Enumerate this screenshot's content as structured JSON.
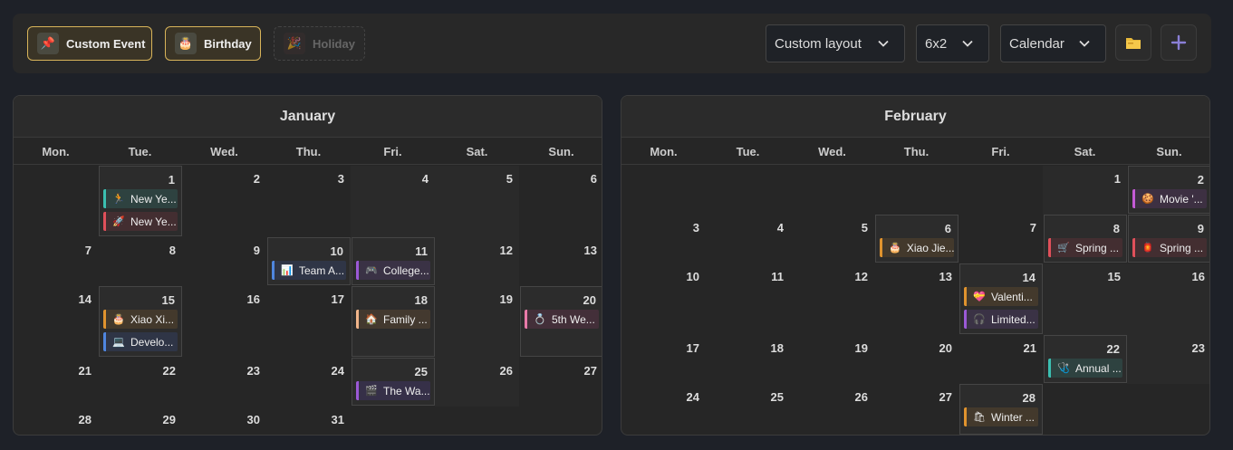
{
  "filters": [
    {
      "label": "Custom Event",
      "icon": "📌",
      "icon_name": "pushpin-icon",
      "active": true
    },
    {
      "label": "Birthday",
      "icon": "🎂",
      "icon_name": "cake-icon",
      "active": true
    },
    {
      "label": "Holiday",
      "icon": "🎉",
      "icon_name": "party-popper-icon",
      "active": false
    }
  ],
  "controls": {
    "layout": "Custom layout",
    "grid": "6x2",
    "view": "Calendar"
  },
  "weekdays": [
    "Mon.",
    "Tue.",
    "Wed.",
    "Thu.",
    "Fri.",
    "Sat.",
    "Sun."
  ],
  "colors": {
    "teal": "#3bbfb1",
    "red": "#e0505a",
    "orange": "#e0932e",
    "blue": "#4f86e0",
    "purple": "#9b59d6",
    "peach": "#f0b48a",
    "pink": "#e87aa8",
    "magenta": "#c55ad6"
  },
  "months": [
    {
      "name": "January",
      "offset": 1,
      "days": 31,
      "rows": [
        {
          "h": 79
        },
        {
          "h": 54
        },
        {
          "h": 79
        },
        {
          "h": 54
        },
        {
          "h": 31
        }
      ],
      "events": {
        "1": [
          {
            "text": "New Ye...",
            "icon": "🏃",
            "color": "#3bbfb1",
            "bg": "#2e4240"
          },
          {
            "text": "New Ye...",
            "icon": "🚀",
            "color": "#e0505a",
            "bg": "#432e31"
          }
        ],
        "10": [
          {
            "text": "Team A...",
            "icon": "📊",
            "color": "#4f86e0",
            "bg": "#2f3546"
          }
        ],
        "11": [
          {
            "text": "College...",
            "icon": "🎮",
            "color": "#9b59d6",
            "bg": "#3a3245"
          }
        ],
        "15": [
          {
            "text": "Xiao Xi...",
            "icon": "🎂",
            "color": "#e0932e",
            "bg": "#43392c"
          },
          {
            "text": "Develo...",
            "icon": "💻",
            "color": "#4f86e0",
            "bg": "#2f3546"
          }
        ],
        "18": [
          {
            "text": "Family ...",
            "icon": "🏠",
            "color": "#f0b48a",
            "bg": "#43392f"
          }
        ],
        "20": [
          {
            "text": "5th We...",
            "icon": "💍",
            "color": "#e87aa8",
            "bg": "#432f39"
          }
        ],
        "25": [
          {
            "text": "The Wa...",
            "icon": "🎬",
            "color": "#9b59d6",
            "bg": "#363048"
          }
        ]
      },
      "boxed": [
        1,
        10,
        11,
        15,
        18,
        20,
        25
      ],
      "shaded": [
        4,
        5,
        11,
        12,
        18,
        19,
        25,
        26
      ]
    },
    {
      "name": "February",
      "offset": 5,
      "days": 28,
      "rows": [
        {
          "h": 54
        },
        {
          "h": 54
        },
        {
          "h": 79
        },
        {
          "h": 54
        },
        {
          "h": 57
        }
      ],
      "events": {
        "2": [
          {
            "text": "Movie '...",
            "icon": "🍪",
            "color": "#c55ad6",
            "bg": "#3d3042"
          }
        ],
        "6": [
          {
            "text": "Xiao Jie...",
            "icon": "🎂",
            "color": "#e0932e",
            "bg": "#43392c"
          }
        ],
        "8": [
          {
            "text": "Spring ...",
            "icon": "🛒",
            "color": "#e0505a",
            "bg": "#432e31"
          }
        ],
        "9": [
          {
            "text": "Spring ...",
            "icon": "🏮",
            "color": "#e0505a",
            "bg": "#432e31"
          }
        ],
        "14": [
          {
            "text": "Valenti...",
            "icon": "💝",
            "color": "#e0932e",
            "bg": "#43392c"
          },
          {
            "text": "Limited...",
            "icon": "🎧",
            "color": "#9b59d6",
            "bg": "#3a3245"
          }
        ],
        "22": [
          {
            "text": "Annual ...",
            "icon": "🩺",
            "color": "#3bbfb1",
            "bg": "#2e4240"
          }
        ],
        "28": [
          {
            "text": "Winter ...",
            "icon": "🛍",
            "color": "#e0932e",
            "bg": "#43392c"
          }
        ]
      },
      "boxed": [
        2,
        6,
        8,
        9,
        14,
        22,
        28
      ],
      "shaded": [
        1,
        2,
        8,
        9,
        15,
        16,
        22,
        23
      ]
    }
  ]
}
